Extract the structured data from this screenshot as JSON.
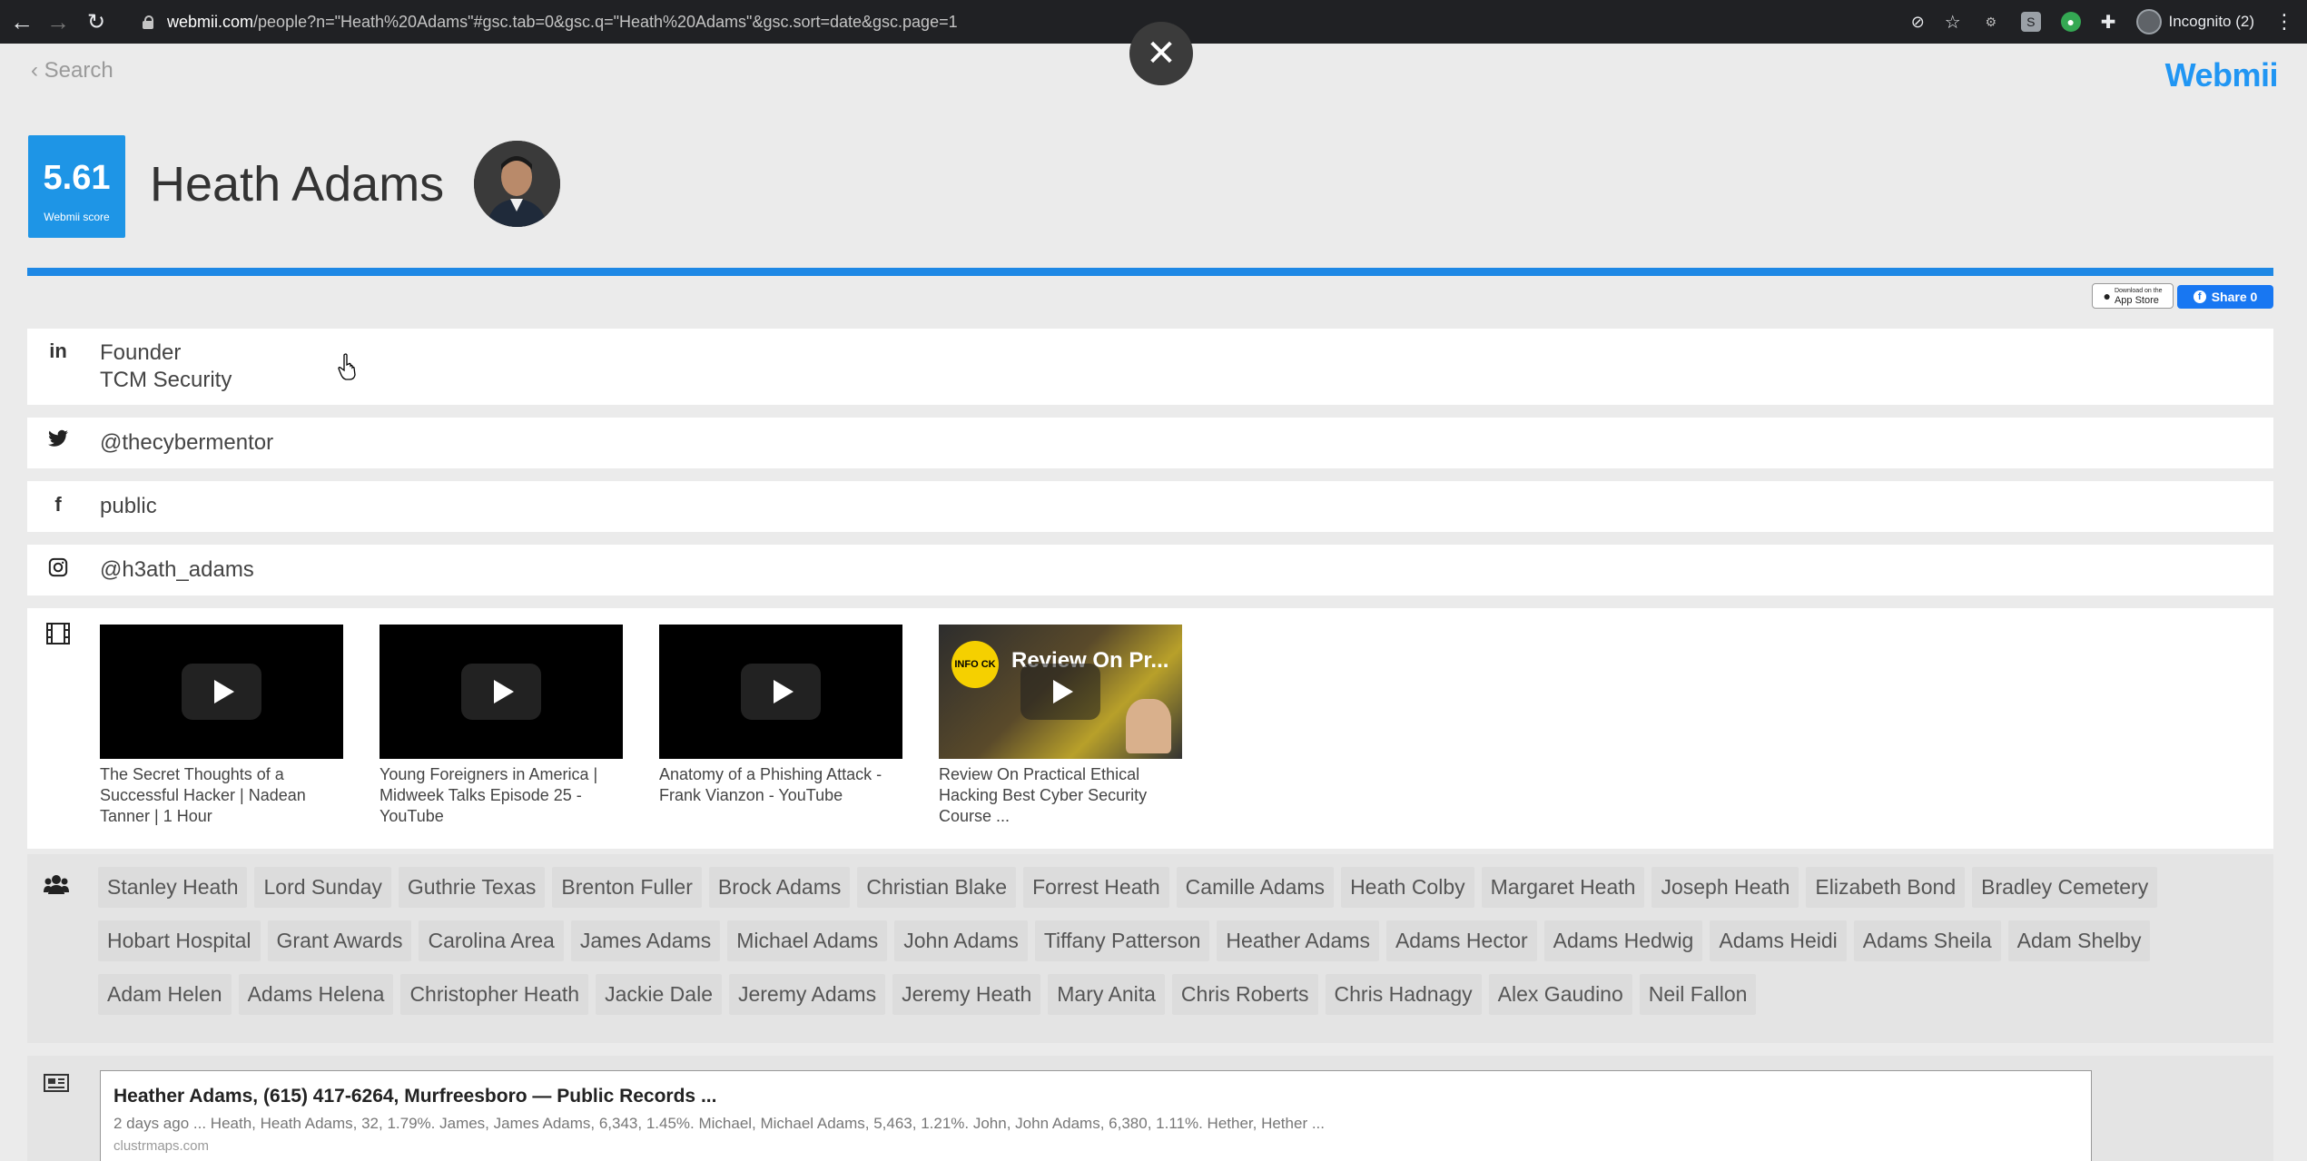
{
  "browser": {
    "url_host": "webmii.com",
    "url_path": "/people?n=\"Heath%20Adams\"#gsc.tab=0&gsc.q=\"Heath%20Adams\"&gsc.sort=date&gsc.page=1",
    "profile_label": "Incognito (2)"
  },
  "page": {
    "back_label": "Search",
    "brand": "Webmii",
    "close_symbol": "✕"
  },
  "profile": {
    "score": "5.61",
    "score_label": "Webmii score",
    "name": "Heath Adams"
  },
  "actions": {
    "appstore_small": "Download on the",
    "appstore_label": "App Store",
    "share_label": "Share 0"
  },
  "linkedin": {
    "icon": "in",
    "line1": "Founder",
    "line2": "TCM Security"
  },
  "twitter": {
    "handle": "@thecybermentor"
  },
  "facebook": {
    "icon": "f",
    "value": "public"
  },
  "instagram": {
    "handle": "@h3ath_adams"
  },
  "videos": [
    {
      "caption": "The Secret Thoughts of a Successful Hacker | Nadean Tanner | 1 Hour"
    },
    {
      "caption": "Young Foreigners in America | Midweek Talks Episode 25 - YouTube"
    },
    {
      "caption": "Anatomy of a Phishing Attack - Frank Vianzon - YouTube"
    },
    {
      "caption": "Review On Practical Ethical Hacking Best Cyber Security Course ...",
      "overlay_logo": "INFO CK",
      "overlay_title": "Review On Pr..."
    }
  ],
  "related_people": [
    "Stanley Heath",
    "Lord Sunday",
    "Guthrie Texas",
    "Brenton Fuller",
    "Brock Adams",
    "Christian Blake",
    "Forrest Heath",
    "Camille Adams",
    "Heath Colby",
    "Margaret Heath",
    "Joseph Heath",
    "Elizabeth Bond",
    "Bradley Cemetery",
    "Hobart Hospital",
    "Grant Awards",
    "Carolina Area",
    "James Adams",
    "Michael Adams",
    "John Adams",
    "Tiffany Patterson",
    "Heather Adams",
    "Adams Hector",
    "Adams Hedwig",
    "Adams Heidi",
    "Adams Sheila",
    "Adam Shelby",
    "Adam Helen",
    "Adams Helena",
    "Christopher Heath",
    "Jackie Dale",
    "Jeremy Adams",
    "Jeremy Heath",
    "Mary Anita",
    "Chris Roberts",
    "Chris Hadnagy",
    "Alex Gaudino",
    "Neil Fallon"
  ],
  "result": {
    "title": "Heather Adams, (615) 417-6264, Murfreesboro — Public Records ...",
    "snippet": "2 days ago ... Heath, Heath Adams, 32, 1.79%. James, James Adams, 6,343, 1.45%. Michael, Michael Adams, 5,463, 1.21%. John, John Adams, 6,380, 1.11%. Hether, Hether ...",
    "url": "clustrmaps.com"
  },
  "colors": {
    "accent": "#1e88e5",
    "score_bg": "#1e95e6",
    "facebook": "#1877f2"
  }
}
